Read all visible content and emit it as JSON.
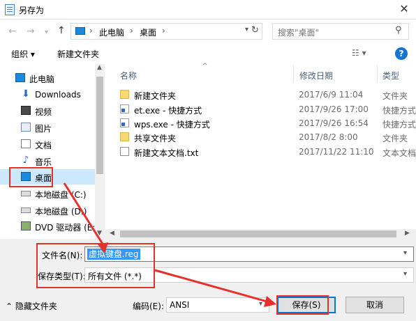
{
  "window": {
    "title": "另存为",
    "close": "✕"
  },
  "nav": {
    "back": "←",
    "forward": "→",
    "up": "↑",
    "breadcrumb": [
      "此电脑",
      "桌面"
    ],
    "search_placeholder": "搜索\"桌面\""
  },
  "toolbar": {
    "organize": "组织 ▾",
    "new_folder": "新建文件夹",
    "help": "?"
  },
  "sidebar": {
    "items": [
      {
        "label": "此电脑",
        "icon": "computer-icon"
      },
      {
        "label": "Downloads",
        "icon": "download-icon"
      },
      {
        "label": "视频",
        "icon": "video-icon"
      },
      {
        "label": "图片",
        "icon": "picture-icon"
      },
      {
        "label": "文档",
        "icon": "document-icon"
      },
      {
        "label": "音乐",
        "icon": "music-icon"
      },
      {
        "label": "桌面",
        "icon": "desktop-icon",
        "selected": true
      },
      {
        "label": "本地磁盘 (C:)",
        "icon": "drive-icon"
      },
      {
        "label": "本地磁盘 (D:)",
        "icon": "drive-icon"
      },
      {
        "label": "DVD 驱动器 (E:)",
        "icon": "dvd-icon"
      }
    ]
  },
  "list": {
    "columns": {
      "name": "名称",
      "date": "修改日期",
      "type": "类型"
    },
    "rows": [
      {
        "name": "新建文件夹",
        "date": "2017/6/9 11:04",
        "type": "文件夹",
        "icon": "folder-icon"
      },
      {
        "name": "et.exe - 快捷方式",
        "date": "2017/9/26 17:00",
        "type": "快捷方式",
        "icon": "shortcut-icon"
      },
      {
        "name": "wps.exe - 快捷方式",
        "date": "2017/9/26 16:54",
        "type": "快捷方式",
        "icon": "shortcut-icon"
      },
      {
        "name": "共享文件夹",
        "date": "2017/8/2 8:00",
        "type": "文件夹",
        "icon": "folder-icon"
      },
      {
        "name": "新建文本文档.txt",
        "date": "2017/11/22 11:10",
        "type": "文本文档",
        "icon": "text-file-icon"
      }
    ]
  },
  "form": {
    "filename_label": "文件名(N):",
    "filename_value": "虚拟键盘.reg",
    "filetype_label": "保存类型(T):",
    "filetype_value": "所有文件 (*.*)",
    "hide_folders": "⌃ 隐藏文件夹",
    "encoding_label": "编码(E):",
    "encoding_value": "ANSI",
    "save": "保存(S)",
    "cancel": "取消"
  },
  "colors": {
    "highlight": "#e8302a",
    "selection": "#cce8ff",
    "accent": "#0078d7"
  }
}
